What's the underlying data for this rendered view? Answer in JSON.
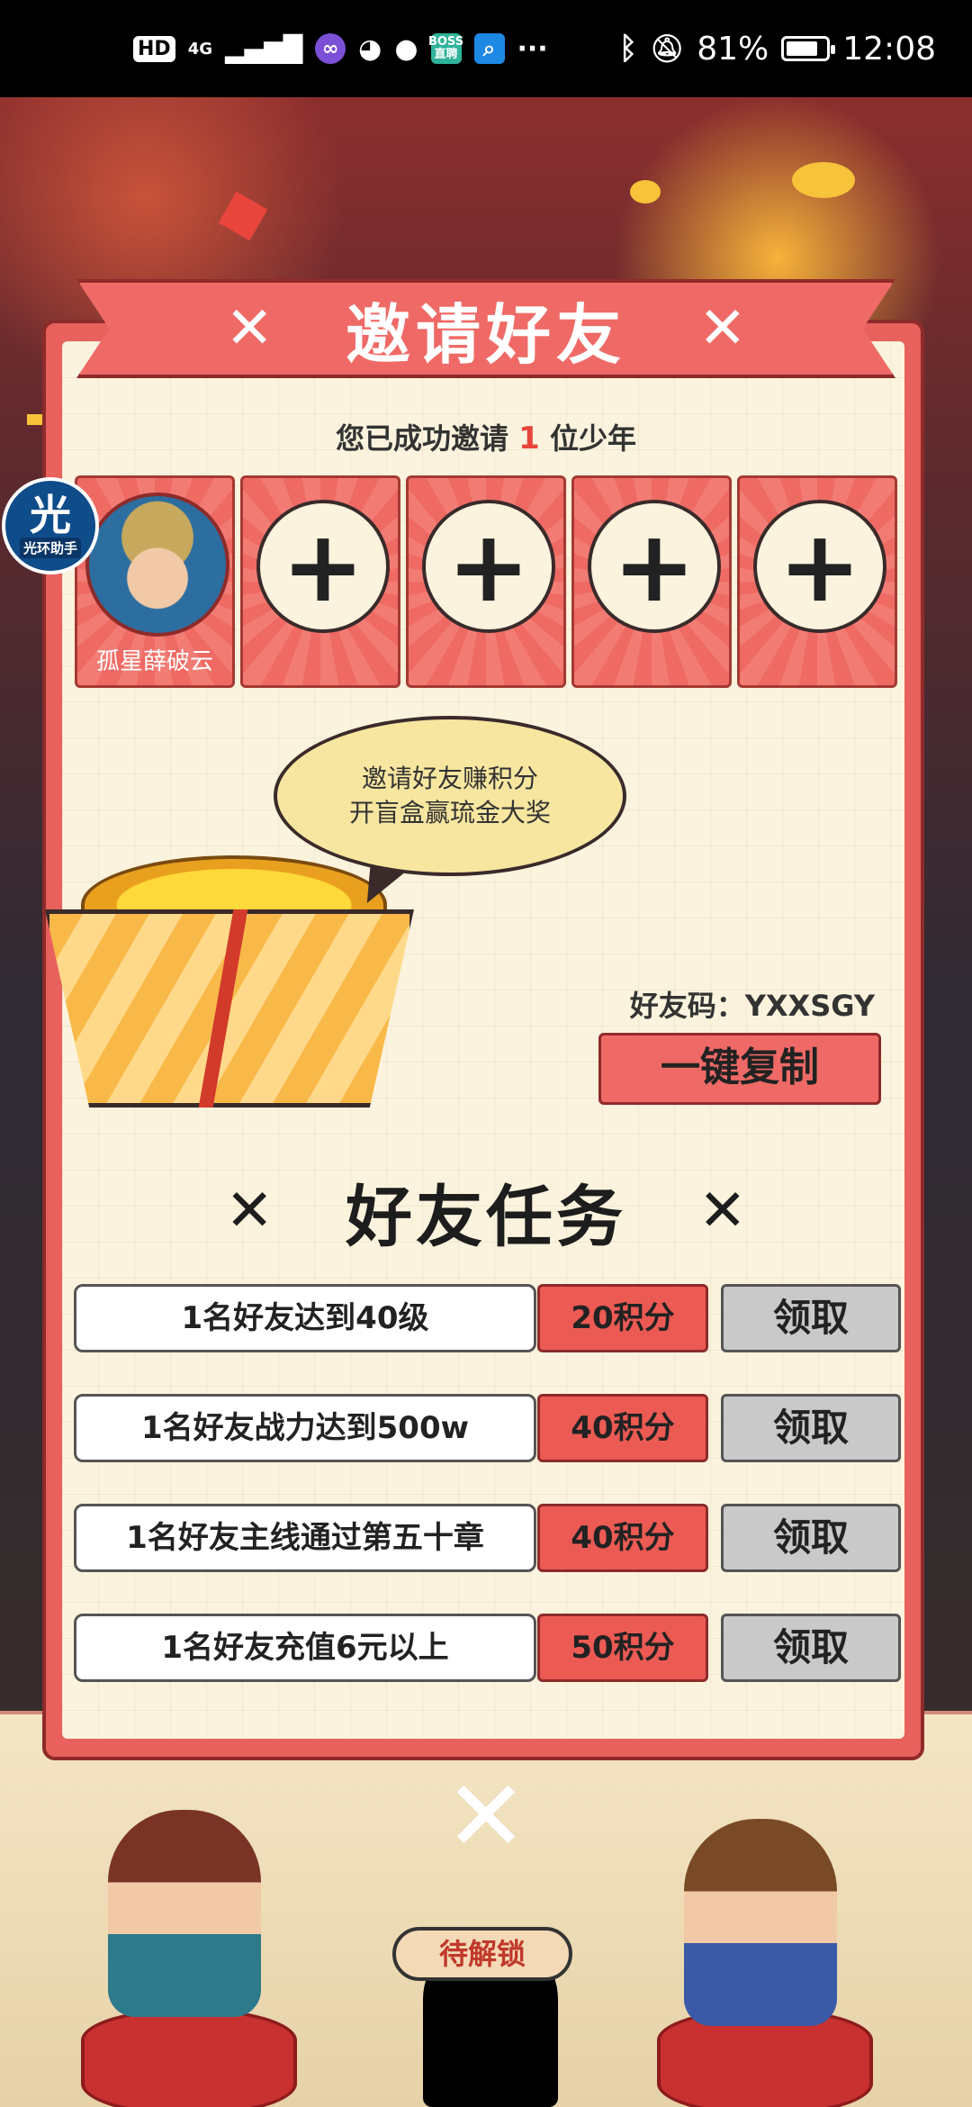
{
  "status_bar": {
    "hd": "HD",
    "network": "4G",
    "more": "···",
    "boss_badge": "BOSS直聘",
    "battery": "81%",
    "time": "12:08"
  },
  "dialog": {
    "title": "邀请好友",
    "invited_prefix": "您已成功邀请",
    "invited_count": "1",
    "invited_suffix": "位少年",
    "friend_slots": [
      {
        "name": "孤星薛破云",
        "filled": true
      },
      {
        "filled": false
      },
      {
        "filled": false
      },
      {
        "filled": false
      },
      {
        "filled": false
      }
    ],
    "plus_symbol": "+",
    "speech_bubble": {
      "line1": "邀请好友赚积分",
      "line2": "开盲盒赢琉金大奖"
    },
    "friend_code_label": "好友码：",
    "friend_code_value": "YXXSGY",
    "copy_button": "一键复制",
    "tasks_title": "好友任务",
    "tasks": [
      {
        "desc": "1名好友达到40级",
        "points": "20积分",
        "action": "领取"
      },
      {
        "desc": "1名好友战力达到500w",
        "points": "40积分",
        "action": "领取"
      },
      {
        "desc": "1名好友主线通过第五十章",
        "points": "40积分",
        "action": "领取"
      },
      {
        "desc": "1名好友充值6元以上",
        "points": "50积分",
        "action": "领取"
      }
    ]
  },
  "helper_badge": {
    "big": "光",
    "small": "光环助手"
  },
  "background": {
    "unlock_tag": "待解锁"
  },
  "colors": {
    "dialog_red": "#e8615d",
    "parchment": "#fbf3dd",
    "points_red": "#ec5a54",
    "claim_gray": "#c9c9c9",
    "accent_count": "#e8453c"
  }
}
